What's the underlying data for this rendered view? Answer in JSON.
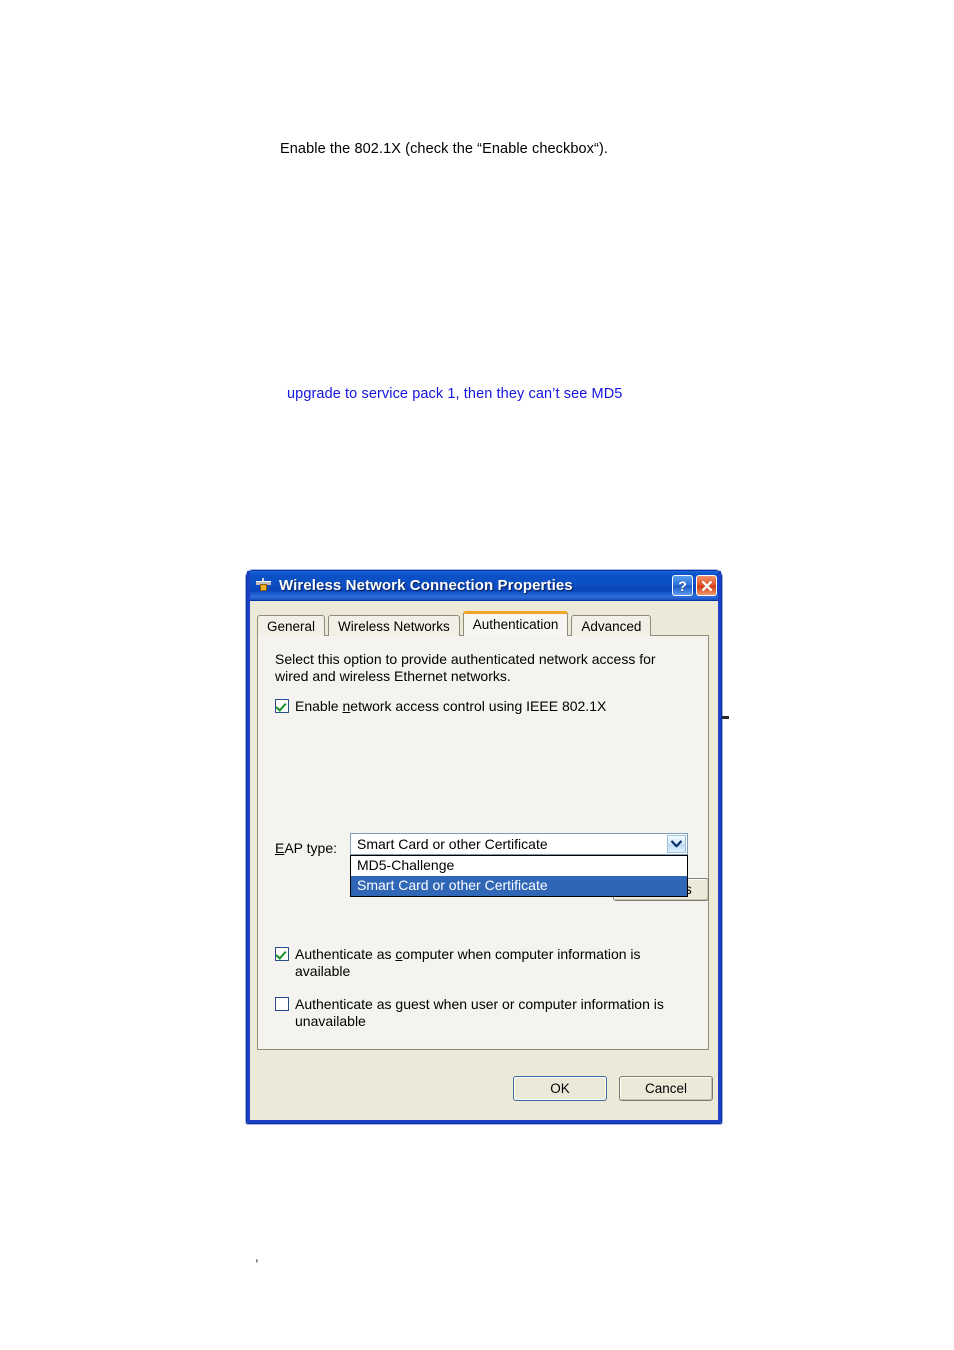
{
  "document": {
    "instruction_line": "Enable the 802.1X (check the “Enable checkbox“).",
    "note_line": "upgrade to service pack 1, then they can’t see MD5",
    "stray_mark": ","
  },
  "dialog": {
    "title": "Wireless Network Connection Properties",
    "icon": "network-connection-icon",
    "caption_buttons": {
      "help_label": "?",
      "close_label": "close-icon"
    },
    "tabs": [
      {
        "label": "General",
        "active": false
      },
      {
        "label": "Wireless Networks",
        "active": false
      },
      {
        "label": "Authentication",
        "active": true
      },
      {
        "label": "Advanced",
        "active": false
      }
    ],
    "panel": {
      "description": "Select this option to provide authenticated network access for wired and wireless Ethernet networks.",
      "enable_8021x": {
        "checked": true,
        "label_pre": "Enable ",
        "label_accel1": "n",
        "label_mid": "etwork access control usin",
        "label_accel2": "g",
        "label_post": " IEEE 802.1X"
      },
      "eap": {
        "label_accel": "E",
        "label_rest": "AP type:",
        "selected_value": "Smart Card or other Certificate",
        "options": [
          {
            "label": "MD5-Challenge",
            "selected": false
          },
          {
            "label": "Smart Card or other Certificate",
            "selected": true
          }
        ],
        "properties_button": "Properties",
        "properties_accel_before": "P",
        "properties_accel": "r",
        "properties_accel_after": "operties"
      },
      "auth_computer": {
        "checked": true,
        "label_pre": "Authenticate as ",
        "label_accel": "c",
        "label_post": "omputer when computer information is available"
      },
      "auth_guest": {
        "checked": false,
        "label_pre": "Authenticate as ",
        "label_accel": "g",
        "label_post": "uest when user or computer information is unavailable"
      }
    },
    "footer": {
      "ok_label": "OK",
      "cancel_label": "Cancel"
    }
  },
  "colors": {
    "titlebar_blue": "#0b51c8",
    "dialog_face": "#ece9d8",
    "panel_face": "#f4f3ef",
    "active_tab_accent": "#f0a426",
    "selection_blue": "#2f66b5",
    "check_green": "#119122",
    "note_text_blue": "#1414e0"
  }
}
